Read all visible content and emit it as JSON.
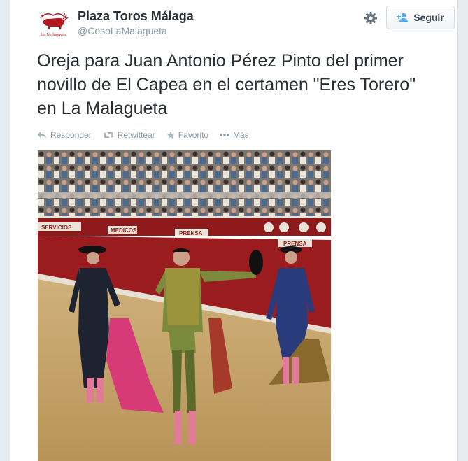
{
  "profile": {
    "name": "Plaza Toros Málaga",
    "handle": "@CosoLaMalagueta",
    "avatar_caption": "La Malagueta"
  },
  "follow_button": {
    "label": "Seguir"
  },
  "tweet": {
    "text": "Oreja para Juan Antonio Pérez Pinto del primer novillo de El Capea en el certamen \"Eres Torero\" en La Malagueta"
  },
  "actions": {
    "reply": "Responder",
    "retweet": "Retwittear",
    "favorite": "Favorito",
    "more": "Más"
  },
  "photo": {
    "signs": {
      "servicios": "SERVICIOS",
      "medicos": "MEDICOS",
      "prensa": "PRENSA",
      "prensa_right": "PRENSA"
    }
  },
  "colors": {
    "page_bg": "#e6ecf0",
    "text": "#292f33",
    "muted": "#8899a6",
    "follow_icon": "#55acee",
    "bullring_red": "#9b1c1f",
    "sand": "#c7a569"
  }
}
